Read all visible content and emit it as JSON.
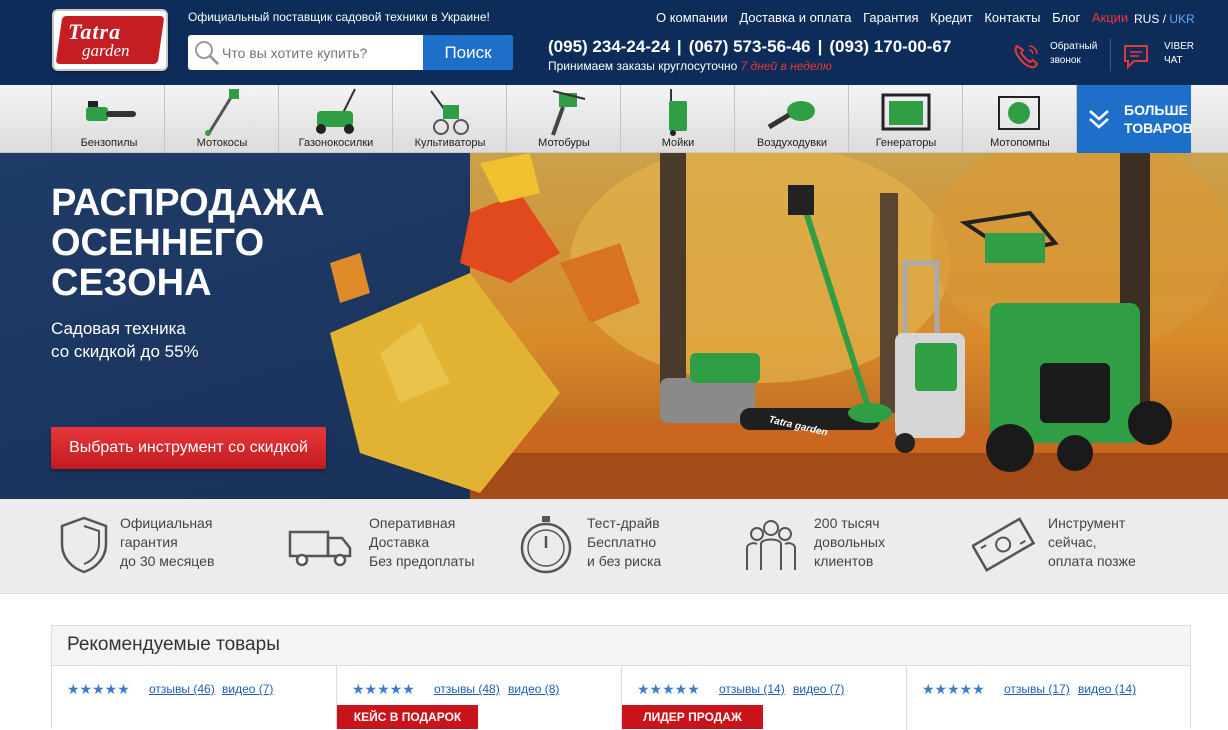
{
  "header": {
    "logo_line1": "Tatra",
    "logo_line2": "garden",
    "tagline": "Официальный поставщик садовой техники в Украине!",
    "search_placeholder": "Что вы хотите купить?",
    "search_button": "Поиск",
    "nav": [
      "О компании",
      "Доставка и оплата",
      "Гарантия",
      "Кредит",
      "Контакты",
      "Блог",
      "Акции"
    ],
    "lang_ru": "RUS",
    "lang_sep": "/",
    "lang_ua": "UKR",
    "phones": [
      "(095) 234-24-24",
      "(067) 573-56-46",
      "(093) 170-00-67"
    ],
    "phone_sep": "|",
    "orders_text": "Принимаем заказы круглосуточно",
    "orders_highlight": "7 дней в неделю",
    "callback_line1": "Обратный",
    "callback_line2": "звонок",
    "viber_line1": "VIBER",
    "viber_line2": "ЧАТ"
  },
  "categories": [
    "Бензопилы",
    "Мотокосы",
    "Газонокосилки",
    "Культиваторы",
    "Мотобуры",
    "Мойки",
    "Воздуходувки",
    "Генераторы",
    "Мотопомпы"
  ],
  "more_products_line1": "БОЛЬШЕ",
  "more_products_line2": "ТОВАРОВ",
  "hero": {
    "title_line1": "РАСПРОДАЖА",
    "title_line2": "ОСЕННЕГО",
    "title_line3": "СЕЗОНА",
    "subtitle_line1": "Садовая техника",
    "subtitle_line2": "со скидкой до 55%",
    "button": "Выбрать инструмент со скидкой",
    "chainsaw_brand": "Tatra garden"
  },
  "features": [
    {
      "icon": "shield-icon",
      "lines": [
        "Официальная",
        "гарантия",
        "до 30 месяцев"
      ]
    },
    {
      "icon": "truck-icon",
      "lines": [
        "Оперативная",
        "Доставка",
        "Без предоплаты"
      ]
    },
    {
      "icon": "stopwatch-icon",
      "lines": [
        "Тест-драйв",
        "Бесплатно",
        "и без риска"
      ]
    },
    {
      "icon": "people-icon",
      "lines": [
        "200 тысяч",
        "довольных",
        "клиентов"
      ]
    },
    {
      "icon": "money-icon",
      "lines": [
        "Инструмент",
        "сейчас,",
        "оплата позже"
      ]
    }
  ],
  "recommended": {
    "title": "Рекомендуемые товары",
    "stars": "★★★★★",
    "items": [
      {
        "reviews": "отзывы (46)",
        "video": "видео (7)",
        "badge": ""
      },
      {
        "reviews": "отзывы (48)",
        "video": "видео (8)",
        "badge": "КЕЙС В ПОДАРОК"
      },
      {
        "reviews": "отзывы (14)",
        "video": "видео (7)",
        "badge": "ЛИДЕР ПРОДАЖ"
      },
      {
        "reviews": "отзывы (17)",
        "video": "видео (14)",
        "badge": ""
      }
    ]
  },
  "colors": {
    "header_bg": "#0e2c5a",
    "accent_blue": "#1d6fc9",
    "accent_red": "#c8141a"
  }
}
